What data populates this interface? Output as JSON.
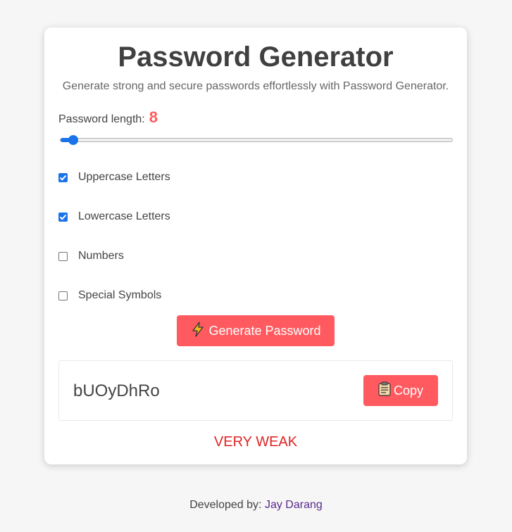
{
  "app": {
    "title": "Password Generator",
    "subtitle": "Generate strong and secure passwords effortlessly with Password Generator."
  },
  "length": {
    "label": "Password length:",
    "value": "8",
    "fraction": 0.0
  },
  "options": [
    {
      "label": "Uppercase Letters",
      "checked": true
    },
    {
      "label": "Lowercase Letters",
      "checked": true
    },
    {
      "label": "Numbers",
      "checked": false
    },
    {
      "label": "Special Symbols",
      "checked": false
    }
  ],
  "generate": {
    "label": "Generate Password",
    "icon": "lightning-icon"
  },
  "result": {
    "password": "bUOyDhRo",
    "copy_label": "Copy",
    "copy_icon": "clipboard-icon"
  },
  "strength": {
    "text": "VERY WEAK",
    "color": "#e02424"
  },
  "footer": {
    "prefix": "Developed by:",
    "author": "Jay Darang"
  },
  "colors": {
    "accent": "#ff5a5f",
    "slider": "#1a73e8"
  }
}
